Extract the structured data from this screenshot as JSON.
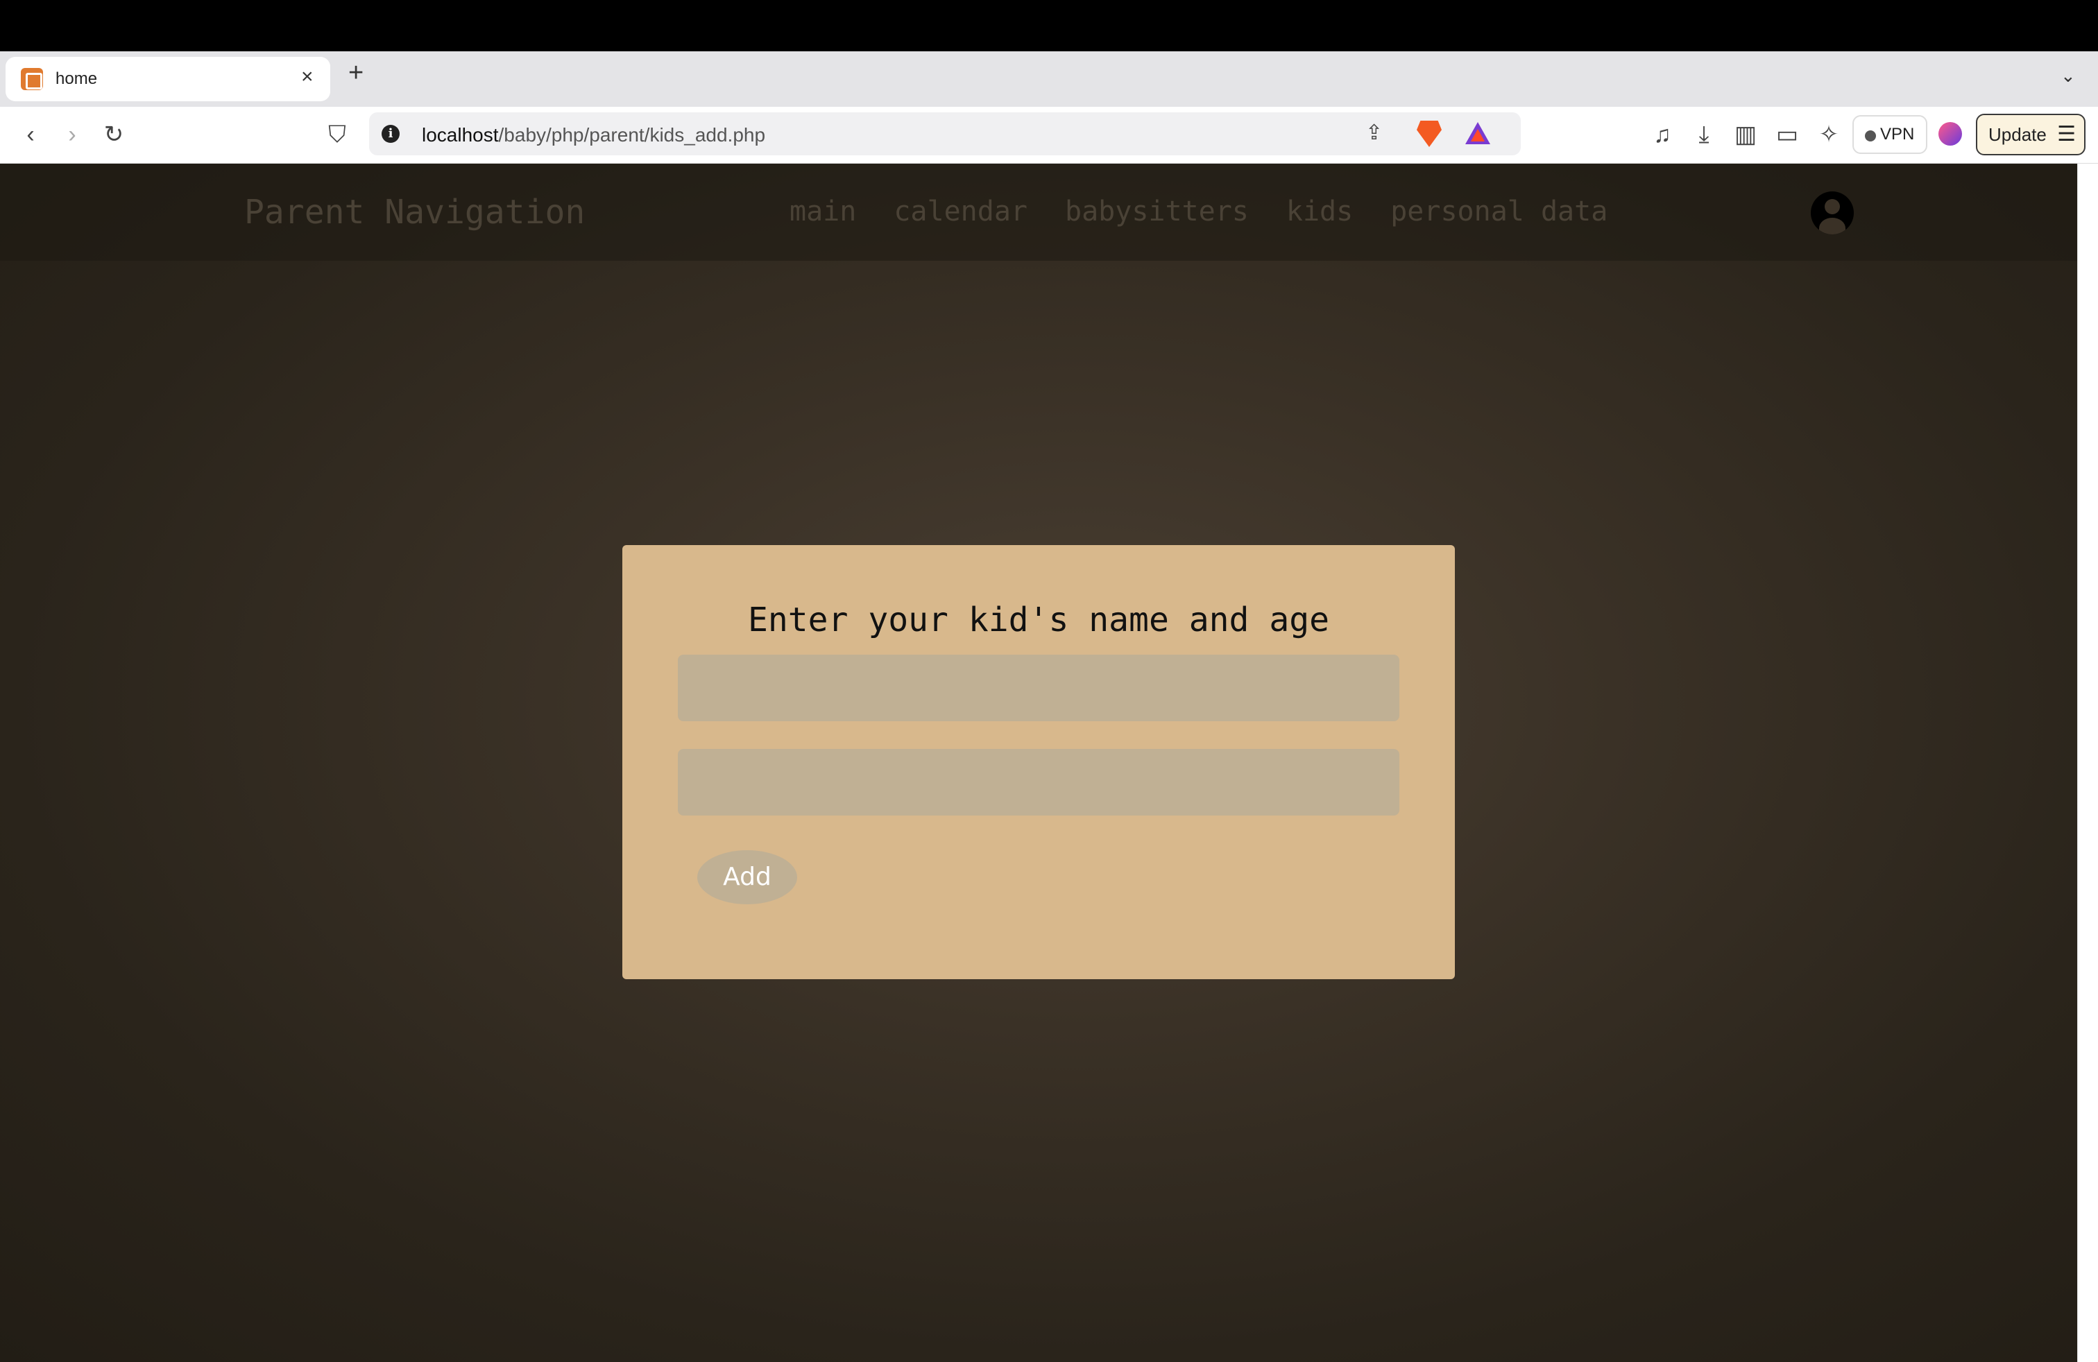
{
  "browser": {
    "tab": {
      "title": "home",
      "close": "×"
    },
    "new_tab": "+",
    "tab_menu": "⌄",
    "url": {
      "host": "localhost",
      "path": "/baby/php/parent/kids_add.php",
      "info": "i"
    },
    "vpn_label": "VPN",
    "update_label": "Update",
    "update_menu_icon": "☰",
    "icons": {
      "back": "‹",
      "forward": "›",
      "reload": "↻",
      "bookmark": "⛉",
      "share": "⇪",
      "media": "♫",
      "download": "⤓",
      "sidebar": "▥",
      "wallet": "▭",
      "leo": "✧"
    }
  },
  "site": {
    "brand": "Parent Navigation",
    "nav": [
      "main",
      "calendar",
      "babysitters",
      "kids",
      "personal data"
    ]
  },
  "form": {
    "title": "Enter your kid's name and age",
    "name_value": "",
    "age_value": "",
    "submit_label": "Add"
  },
  "colors": {
    "card": "#d8b88c",
    "field": "#c0b094",
    "page_bg": "#3a3126"
  }
}
